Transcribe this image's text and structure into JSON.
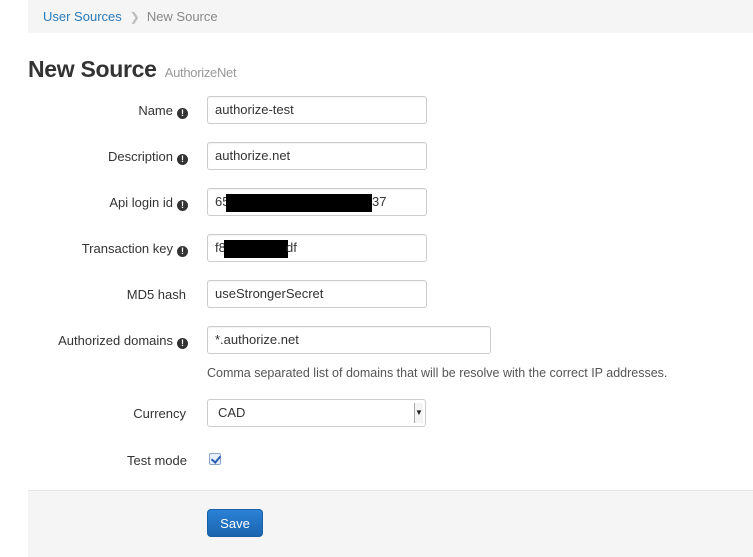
{
  "breadcrumb": {
    "parent": "User Sources",
    "current": "New Source"
  },
  "page": {
    "title": "New Source",
    "subtitle": "AuthorizeNet"
  },
  "form": {
    "name": {
      "label": "Name",
      "value": "authorize-test"
    },
    "description": {
      "label": "Description",
      "value": "authorize.net"
    },
    "api_login_id": {
      "label": "Api login id",
      "value_prefix": "65",
      "value_suffix": "37"
    },
    "transaction_key": {
      "label": "Transaction key",
      "value_prefix": "f8",
      "value_suffix": "df"
    },
    "md5_hash": {
      "label": "MD5 hash",
      "value": "useStrongerSecret"
    },
    "authorized_domains": {
      "label": "Authorized domains",
      "value": "*.authorize.net",
      "help": "Comma separated list of domains that will be resolve with the correct IP addresses."
    },
    "currency": {
      "label": "Currency",
      "value": "CAD"
    },
    "test_mode": {
      "label": "Test mode",
      "checked": true
    }
  },
  "actions": {
    "save_label": "Save"
  },
  "colors": {
    "link": "#2a7bbd",
    "primary_button": "#1f6fbd",
    "panel_bg": "#f5f5f5"
  },
  "icons": {
    "info": "info-circle-icon",
    "separator": "chevron-right-icon",
    "dropdown": "caret-down-icon"
  }
}
